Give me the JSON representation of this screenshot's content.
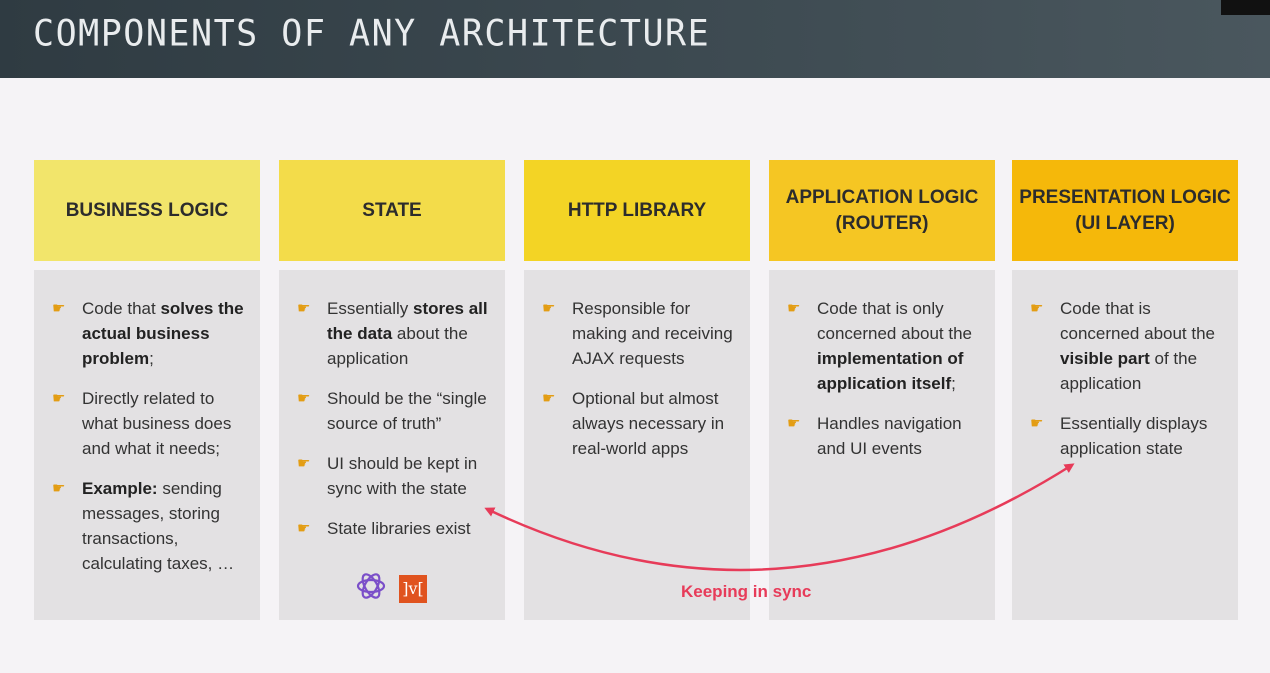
{
  "title": "COMPONENTS OF ANY ARCHITECTURE",
  "columns": [
    {
      "heading": "BUSINESS LOGIC",
      "color": "#f2e56b",
      "items": [
        [
          {
            "t": "Code that "
          },
          {
            "t": "solves the actual business problem",
            "b": true
          },
          {
            "t": ";"
          }
        ],
        [
          {
            "t": "Directly related to what business does and what it needs;"
          }
        ],
        [
          {
            "t": "Example:",
            "b": true
          },
          {
            "t": " sending messages, storing transactions, calculating taxes, …"
          }
        ]
      ]
    },
    {
      "heading": "STATE",
      "color": "#f3dc4a",
      "items": [
        [
          {
            "t": "Essentially "
          },
          {
            "t": "stores all the data",
            "b": true
          },
          {
            "t": " about the application"
          }
        ],
        [
          {
            "t": "Should be the “single source of truth”"
          }
        ],
        [
          {
            "t": "UI should be kept in sync with the state"
          }
        ],
        [
          {
            "t": "State libraries exist"
          }
        ]
      ],
      "libraries": [
        "redux-logo-icon",
        "mobx-logo-icon"
      ]
    },
    {
      "heading": "HTTP LIBRARY",
      "color": "#f3d425",
      "items": [
        [
          {
            "t": "Responsible for making and receiving AJAX requests"
          }
        ],
        [
          {
            "t": "Optional but almost always necessary in real-world apps"
          }
        ]
      ]
    },
    {
      "heading": "APPLICATION LOGIC (ROUTER)",
      "color": "#f5c623",
      "items": [
        [
          {
            "t": "Code that is only concerned about the "
          },
          {
            "t": "implementation of application itself",
            "b": true
          },
          {
            "t": ";"
          }
        ],
        [
          {
            "t": "Handles navigation and UI events"
          }
        ]
      ]
    },
    {
      "heading": "PRESENTATION LOGIC (UI LAYER)",
      "color": "#f5b80a",
      "items": [
        [
          {
            "t": "Code that is concerned about the "
          },
          {
            "t": "visible part",
            "b": true
          },
          {
            "t": " of the application"
          }
        ],
        [
          {
            "t": "Essentially displays application state"
          }
        ]
      ]
    }
  ],
  "sync_label": "Keeping in sync",
  "bullet_icon": "pointing-hand-icon",
  "accent_color": "#e73b59"
}
